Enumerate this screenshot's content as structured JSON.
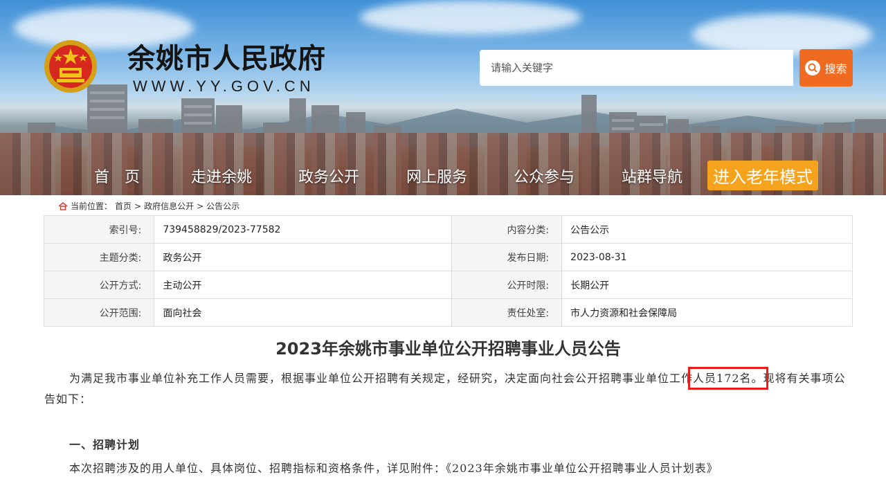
{
  "header": {
    "site_title": "余姚市人民政府",
    "site_url": "WWW.YY.GOV.CN",
    "search_placeholder": "请输入关键字",
    "search_button": "搜索"
  },
  "nav": {
    "items": [
      "首　页",
      "走进余姚",
      "政务公开",
      "网上服务",
      "公众参与",
      "站群导航"
    ],
    "elder_mode": "进入老年模式"
  },
  "breadcrumb": {
    "prefix": "当前位置：",
    "items": [
      "首页",
      "政府信息公开",
      "公告公示"
    ],
    "separator": ">"
  },
  "info": {
    "rows": [
      {
        "l1": "索引号:",
        "v1": "739458829/2023-77582",
        "l2": "内容分类:",
        "v2": "公告公示"
      },
      {
        "l1": "主题分类:",
        "v1": "政务公开",
        "l2": "发布日期:",
        "v2": "2023-08-31"
      },
      {
        "l1": "公开方式:",
        "v1": "主动公开",
        "l2": "公开时限:",
        "v2": "长期公开"
      },
      {
        "l1": "公开范围:",
        "v1": "面向社会",
        "l2": "责任处室:",
        "v2": "市人力资源和社会保障局"
      }
    ]
  },
  "article": {
    "title": "2023年余姚市事业单位公开招聘事业人员公告",
    "para1_before": "为满足我市事业单位补充工作人员需要，根据事业单位公开招聘有关规定，经研究，决定面向社会公开招聘事业单位工作",
    "para1_highlight": "人员172名。",
    "para1_after": "现将有关事项公告如下：",
    "section1": "一、招聘计划",
    "para2": "本次招聘涉及的用人单位、具体岗位、招聘指标和资格条件，详见附件：《2023年余姚市事业单位公开招聘事业人员计划表》"
  },
  "colors": {
    "search_button": "#f06b22",
    "elder_mode": "#f5a21d",
    "highlight_box": "#ee1b1b"
  },
  "icons": [
    "national-emblem-icon",
    "search-icon",
    "home-icon"
  ]
}
